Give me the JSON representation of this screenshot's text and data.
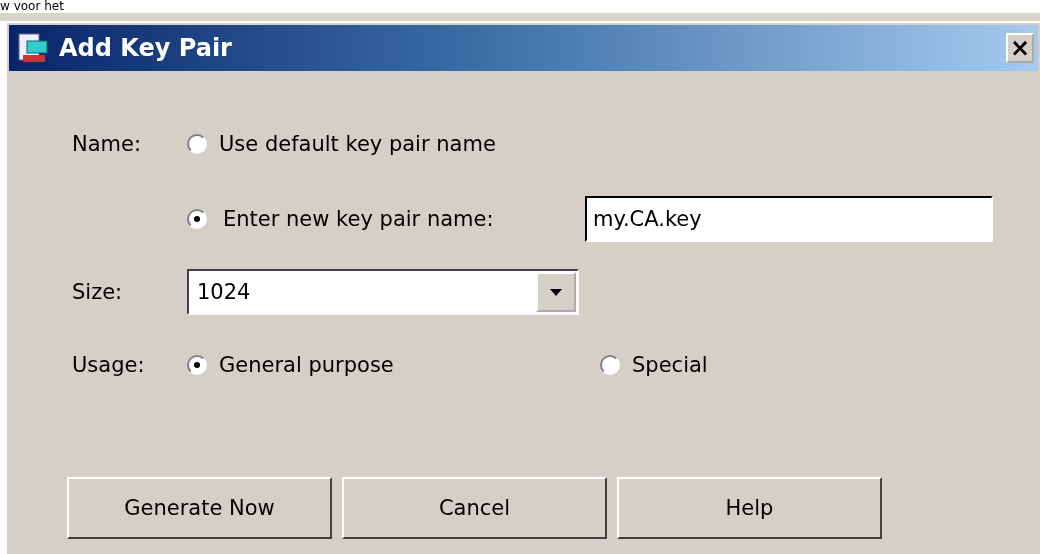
{
  "background_text": "w voor het",
  "window": {
    "title": "Add Key Pair",
    "close": "×"
  },
  "name": {
    "label": "Name:",
    "options": [
      {
        "label": "Use default key pair name",
        "selected": false
      },
      {
        "label": "Enter new key pair name:",
        "selected": true
      }
    ],
    "value": "my.CA.key"
  },
  "size": {
    "label": "Size:",
    "value": "1024"
  },
  "usage": {
    "label": "Usage:",
    "options": [
      {
        "label": "General purpose",
        "selected": true
      },
      {
        "label": "Special",
        "selected": false
      }
    ]
  },
  "buttons": [
    "Generate Now",
    "Cancel",
    "Help"
  ]
}
